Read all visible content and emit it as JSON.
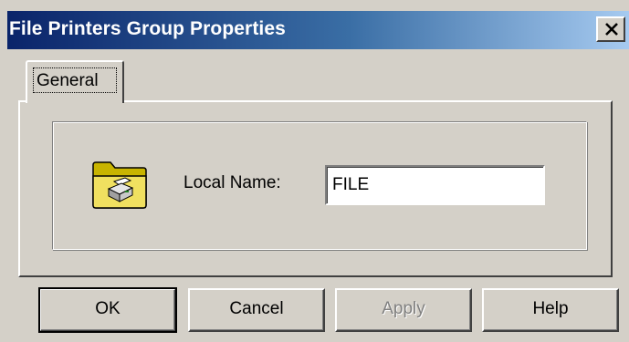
{
  "window": {
    "title": "File Printers Group Properties",
    "close_label": "✕"
  },
  "tabs": [
    {
      "label": "General",
      "selected": true
    }
  ],
  "general": {
    "icon": "printer-folder-icon",
    "local_name_label": "Local Name:",
    "local_name_value": "FILE"
  },
  "buttons": {
    "ok": "OK",
    "cancel": "Cancel",
    "apply": "Apply",
    "help": "Help"
  },
  "colors": {
    "title_gradient_start": "#0a246a",
    "title_gradient_end": "#a6caf0",
    "face": "#d4d0c8"
  }
}
